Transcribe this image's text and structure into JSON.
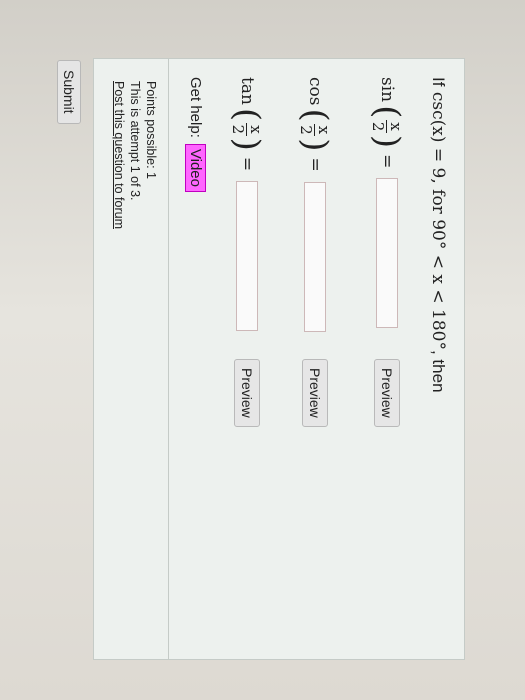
{
  "question": {
    "lead": "If",
    "condition_math": "csc(x) = 9, for 90° < x < 180°",
    "tail": ", then"
  },
  "rows": [
    {
      "func": "sin",
      "numerator": "x",
      "denominator": "2",
      "equals": "=",
      "answer_value": "",
      "preview_label": "Preview"
    },
    {
      "func": "cos",
      "numerator": "x",
      "denominator": "2",
      "equals": "=",
      "answer_value": "",
      "preview_label": "Preview"
    },
    {
      "func": "tan",
      "numerator": "x",
      "denominator": "2",
      "equals": "=",
      "answer_value": "",
      "preview_label": "Preview"
    }
  ],
  "help": {
    "label": "Get help:",
    "video_label": "Video"
  },
  "info": {
    "points": "Points possible: 1",
    "attempt": "This is attempt 1 of 3.",
    "forum_link": "Post this question to forum"
  },
  "submit_label": "Submit",
  "colors": {
    "video_button": "#ff66ff",
    "card_background": "#edf1ee"
  }
}
